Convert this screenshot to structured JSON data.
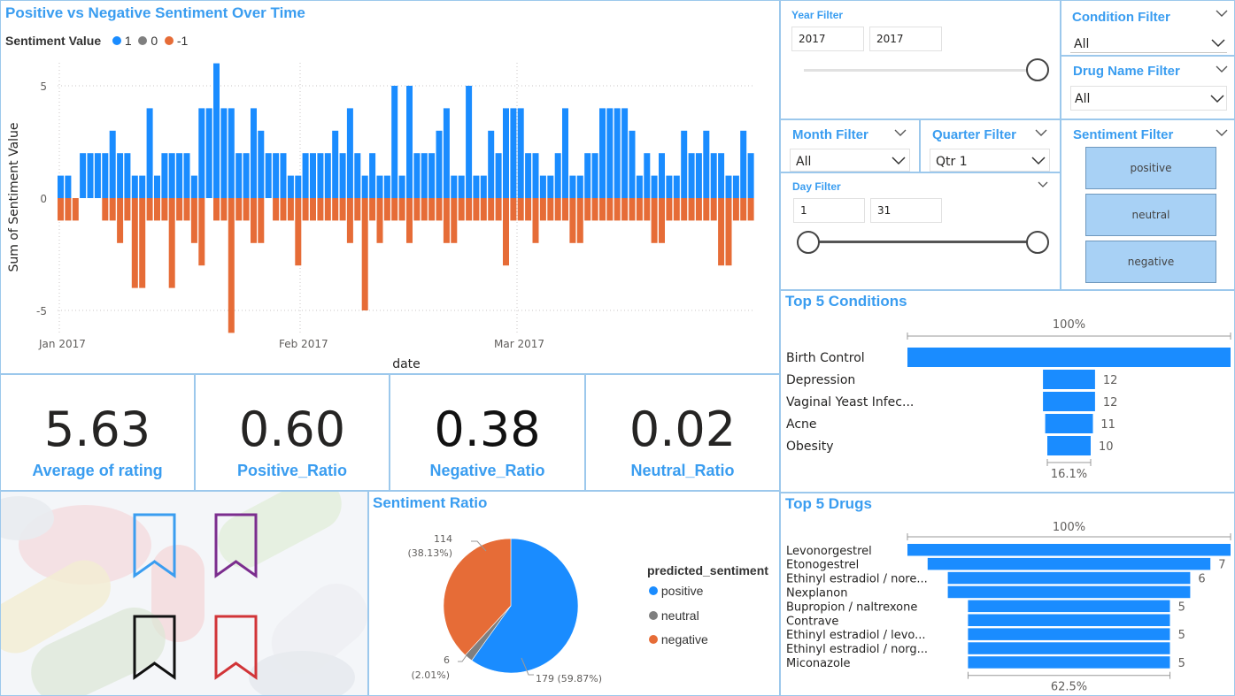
{
  "colors": {
    "accent": "#3a9df0",
    "positive": "#1a8cff",
    "neutral": "#7f7f7f",
    "negative": "#e66c37",
    "panel_border": "#9cc8ec"
  },
  "timeseries": {
    "title": "Positive vs Negative Sentiment Over Time",
    "legend_title": "Sentiment Value",
    "legend": [
      {
        "label": "1",
        "color": "#1a8cff"
      },
      {
        "label": "0",
        "color": "#7f7f7f"
      },
      {
        "label": "-1",
        "color": "#e66c37"
      }
    ],
    "ylabel": "Sum of Sentiment Value",
    "xlabel": "date",
    "yticks": [
      "5",
      "0",
      "-5"
    ],
    "xticks": [
      "Jan 2017",
      "Feb 2017",
      "Mar 2017"
    ]
  },
  "chart_data": [
    {
      "type": "bar",
      "title": "Positive vs Negative Sentiment Over Time",
      "xlabel": "date",
      "ylabel": "Sum of Sentiment Value",
      "ylim": [
        -6,
        6
      ],
      "x_range": [
        "2017-01-01",
        "2017-03-31"
      ],
      "grid": true,
      "legend_position": "top-left",
      "series": [
        {
          "name": "1",
          "values": [
            1,
            1,
            0,
            2,
            2,
            2,
            2,
            3,
            2,
            2,
            1,
            1,
            4,
            1,
            2,
            2,
            2,
            2,
            1,
            4,
            4,
            6,
            4,
            4,
            2,
            2,
            4,
            3,
            2,
            2,
            2,
            1,
            1,
            2,
            2,
            2,
            2,
            3,
            2,
            4,
            2,
            1,
            2,
            1,
            1,
            5,
            1,
            5,
            2,
            2,
            2,
            3,
            4,
            1,
            1,
            5,
            1,
            1,
            3,
            2,
            4,
            4,
            4,
            2,
            2,
            1,
            1,
            2,
            4,
            1,
            1,
            2,
            2,
            4,
            4,
            4,
            4,
            3,
            1,
            2,
            1,
            2,
            1,
            1,
            3,
            2,
            2,
            3,
            2,
            2,
            1,
            1,
            3,
            2
          ]
        },
        {
          "name": "-1",
          "values": [
            -1,
            -1,
            -1,
            0,
            0,
            0,
            -1,
            -1,
            -2,
            -1,
            -4,
            -4,
            -1,
            -1,
            -1,
            -4,
            -1,
            -1,
            -2,
            -3,
            0,
            -1,
            -1,
            -6,
            -1,
            -1,
            -2,
            -2,
            0,
            -1,
            -1,
            -1,
            -3,
            -1,
            -1,
            -1,
            -1,
            -1,
            -1,
            -2,
            -1,
            -5,
            -1,
            -2,
            -1,
            -1,
            -1,
            -2,
            -1,
            -1,
            -1,
            -1,
            -2,
            -2,
            -1,
            -1,
            -1,
            -1,
            -1,
            -1,
            -3,
            -1,
            -1,
            -1,
            -2,
            -1,
            -1,
            -1,
            -1,
            -2,
            -2,
            -1,
            -1,
            -1,
            -1,
            -1,
            -1,
            -1,
            -1,
            -1,
            -2,
            -2,
            -1,
            -1,
            -1,
            -1,
            -1,
            -1,
            -1,
            -3,
            -3,
            -1,
            -1,
            -1
          ]
        }
      ]
    },
    {
      "type": "pie",
      "title": "Sentiment Ratio",
      "legend_title": "predicted_sentiment",
      "legend_position": "right",
      "categories": [
        "positive",
        "neutral",
        "negative"
      ],
      "values": [
        179,
        6,
        114
      ],
      "percentages": [
        "59.87%",
        "2.01%",
        "38.13%"
      ]
    },
    {
      "type": "bar",
      "title": "Top 5 Conditions",
      "orientation": "horizontal-funnel",
      "categories": [
        "Birth Control",
        "Depression",
        "Vaginal Yeast Infec...",
        "Acne",
        "Obesity"
      ],
      "values": [
        74.5,
        12,
        12,
        11,
        10
      ],
      "data_labels": [
        "",
        "12",
        "12",
        "11",
        "10"
      ],
      "top_label": "100%",
      "bottom_label": "16.1%"
    },
    {
      "type": "bar",
      "title": "Top 5 Drugs",
      "orientation": "horizontal-funnel",
      "categories": [
        "Levonorgestrel",
        "Etonogestrel",
        "Ethinyl estradiol / nore...",
        "Nexplanon",
        "Bupropion / naltrexone",
        "Contrave",
        "Ethinyl estradiol / levo...",
        "Ethinyl estradiol / norg...",
        "Miconazole"
      ],
      "values": [
        8,
        7,
        6,
        6,
        5,
        5,
        5,
        5,
        5
      ],
      "data_labels": [
        "",
        "7",
        "6",
        "",
        "5",
        "",
        "5",
        "",
        "5"
      ],
      "top_label": "100%",
      "bottom_label": "62.5%"
    }
  ],
  "kpis": [
    {
      "value": "5.63",
      "label": "Average of rating"
    },
    {
      "value": "0.60",
      "label": "Positive_Ratio"
    },
    {
      "value": "0.38",
      "label": "Negative_Ratio"
    },
    {
      "value": "0.02",
      "label": "Neutral_Ratio"
    }
  ],
  "pie": {
    "title": "Sentiment Ratio",
    "legend_title": "predicted_sentiment",
    "legend": [
      "positive",
      "neutral",
      "negative"
    ],
    "labels": [
      {
        "count": "114",
        "pct": "(38.13%)"
      },
      {
        "count": "6",
        "pct": "(2.01%)"
      },
      {
        "text": "179 (59.87%)"
      }
    ]
  },
  "filters": {
    "year": {
      "title": "Year Filter",
      "from": "2017",
      "to": "2017"
    },
    "condition": {
      "title": "Condition Filter",
      "value": "All"
    },
    "drug": {
      "title": "Drug Name Filter",
      "value": "All"
    },
    "month": {
      "title": "Month Filter",
      "value": "All"
    },
    "quarter": {
      "title": "Quarter Filter",
      "value": "Qtr 1"
    },
    "day": {
      "title": "Day Filter",
      "from": "1",
      "to": "31"
    },
    "sentiment": {
      "title": "Sentiment Filter",
      "options": [
        "positive",
        "neutral",
        "negative"
      ]
    }
  },
  "bookmarks": [
    {
      "name": "bookmark-blue",
      "color": "#3a9df0"
    },
    {
      "name": "bookmark-purple",
      "color": "#7b2d8e"
    },
    {
      "name": "bookmark-black",
      "color": "#111111"
    },
    {
      "name": "bookmark-red",
      "color": "#d13438"
    }
  ]
}
